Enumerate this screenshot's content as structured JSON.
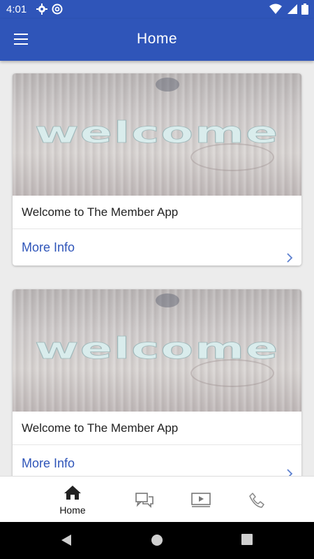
{
  "status_bar": {
    "time": "4:01",
    "left_icons": [
      "gear-icon",
      "at-sign-icon"
    ],
    "right_icons": [
      "wifi-icon",
      "signal-icon",
      "battery-icon"
    ]
  },
  "app_bar": {
    "title": "Home",
    "menu_icon": "menu-icon"
  },
  "cards": [
    {
      "image_text": "welcome",
      "title": "Welcome to The Member App",
      "link_label": "More Info"
    },
    {
      "image_text": "welcome",
      "title": "Welcome to The Member App",
      "link_label": "More Info"
    }
  ],
  "bottom_nav": {
    "items": [
      {
        "label": "Home",
        "icon": "home-icon",
        "active": true
      },
      {
        "label": "",
        "icon": "chat-icon",
        "active": false
      },
      {
        "label": "",
        "icon": "video-icon",
        "active": false
      },
      {
        "label": "",
        "icon": "phone-icon",
        "active": false
      }
    ]
  },
  "system_nav": {
    "buttons": [
      "back-icon",
      "home-circle-icon",
      "recents-icon"
    ]
  },
  "colors": {
    "primary": "#2f55b9",
    "link": "#2f55b9",
    "background": "#ececec"
  }
}
